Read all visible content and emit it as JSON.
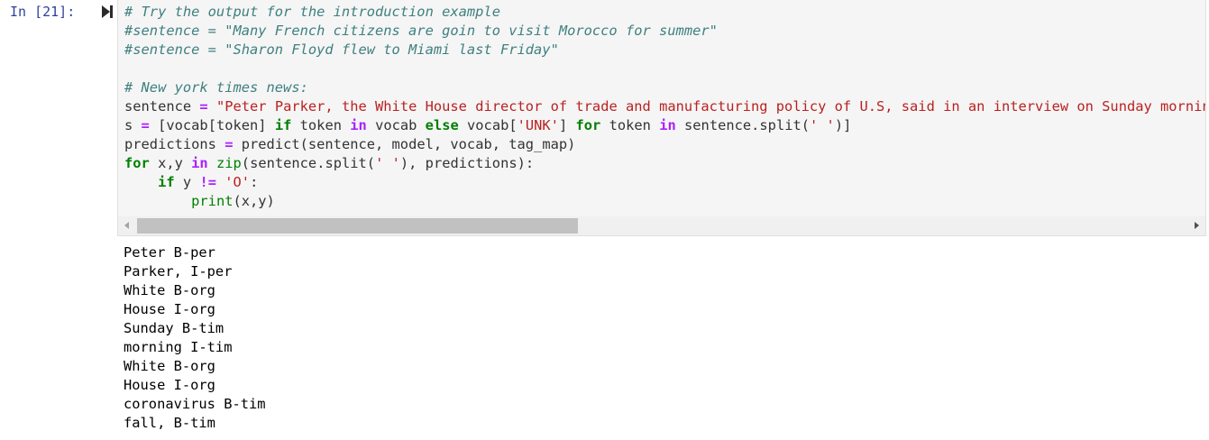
{
  "cell": {
    "prompt": "In [21]:",
    "code_lines": [
      [
        {
          "t": "cm",
          "v": "# Try the output for the introduction example"
        }
      ],
      [
        {
          "t": "cm",
          "v": "#sentence = \"Many French citizens are goin to visit Morocco for summer\""
        }
      ],
      [
        {
          "t": "cm",
          "v": "#sentence = \"Sharon Floyd flew to Miami last Friday\""
        }
      ],
      [],
      [
        {
          "t": "cm",
          "v": "# New york times news:"
        }
      ],
      [
        {
          "t": "",
          "v": "sentence "
        },
        {
          "t": "op",
          "v": "="
        },
        {
          "t": "",
          "v": " "
        },
        {
          "t": "st",
          "v": "\"Peter Parker, the White House director of trade and manufacturing policy of U.S, said in an interview on Sunday morning that the White House was working to prepare for the possibility of a second wave of the coronavirus in the fall, though he said it wouldn’t necessarily come\""
        }
      ],
      [
        {
          "t": "",
          "v": "s "
        },
        {
          "t": "op",
          "v": "="
        },
        {
          "t": "",
          "v": " [vocab[token] "
        },
        {
          "t": "kw",
          "v": "if"
        },
        {
          "t": "",
          "v": " token "
        },
        {
          "t": "op",
          "v": "in"
        },
        {
          "t": "",
          "v": " vocab "
        },
        {
          "t": "kw",
          "v": "else"
        },
        {
          "t": "",
          "v": " vocab["
        },
        {
          "t": "st",
          "v": "'UNK'"
        },
        {
          "t": "",
          "v": "] "
        },
        {
          "t": "kw",
          "v": "for"
        },
        {
          "t": "",
          "v": " token "
        },
        {
          "t": "op",
          "v": "in"
        },
        {
          "t": "",
          "v": " sentence.split("
        },
        {
          "t": "st",
          "v": "' '"
        },
        {
          "t": "",
          "v": ")]"
        }
      ],
      [
        {
          "t": "",
          "v": "predictions "
        },
        {
          "t": "op",
          "v": "="
        },
        {
          "t": "",
          "v": " predict(sentence, model, vocab, tag_map)"
        }
      ],
      [
        {
          "t": "kw",
          "v": "for"
        },
        {
          "t": "",
          "v": " x,y "
        },
        {
          "t": "op",
          "v": "in"
        },
        {
          "t": "",
          "v": " "
        },
        {
          "t": "bi",
          "v": "zip"
        },
        {
          "t": "",
          "v": "(sentence.split("
        },
        {
          "t": "st",
          "v": "' '"
        },
        {
          "t": "",
          "v": "), predictions):"
        }
      ],
      [
        {
          "t": "",
          "v": "    "
        },
        {
          "t": "kw",
          "v": "if"
        },
        {
          "t": "",
          "v": " y "
        },
        {
          "t": "op",
          "v": "!="
        },
        {
          "t": "",
          "v": " "
        },
        {
          "t": "st",
          "v": "'O'"
        },
        {
          "t": "",
          "v": ":"
        }
      ],
      [
        {
          "t": "",
          "v": "        "
        },
        {
          "t": "bi",
          "v": "print"
        },
        {
          "t": "",
          "v": "(x,y)"
        }
      ]
    ],
    "output_lines": [
      "Peter B-per",
      "Parker, I-per",
      "White B-org",
      "House I-org",
      "Sunday B-tim",
      "morning I-tim",
      "White B-org",
      "House I-org",
      "coronavirus B-tim",
      "fall, B-tim"
    ]
  },
  "colors": {
    "prompt": "#303f9f",
    "comment": "#408080",
    "keyword": "#008000",
    "operator": "#aa22ff",
    "string": "#ba2121",
    "input_background": "#f5f5f5"
  },
  "icons": {
    "run": "run-cell-icon"
  },
  "scrollbar": {
    "thumb_fraction": 0.42
  }
}
